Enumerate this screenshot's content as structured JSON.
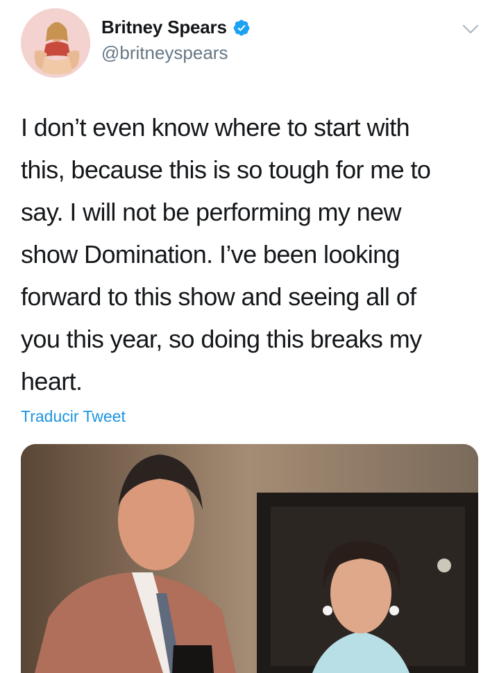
{
  "tweet": {
    "author_name": "Britney Spears",
    "author_handle": "@britneyspears",
    "text": "I don’t even know where to start with\nthis, because this is so tough for me to\nsay. I will not be performing my new\nshow Domination. I’ve been looking\nforward to this show and seeing all of\nyou this year, so doing this breaks my\nheart.",
    "translate_label": "Traducir Tweet"
  },
  "icons": {
    "verified": "verified-badge-icon",
    "more": "chevron-down-icon"
  },
  "colors": {
    "verified_blue": "#1da1f2",
    "link_blue": "#1b95e0",
    "handle_gray": "#657786",
    "text_dark": "#14171a"
  }
}
